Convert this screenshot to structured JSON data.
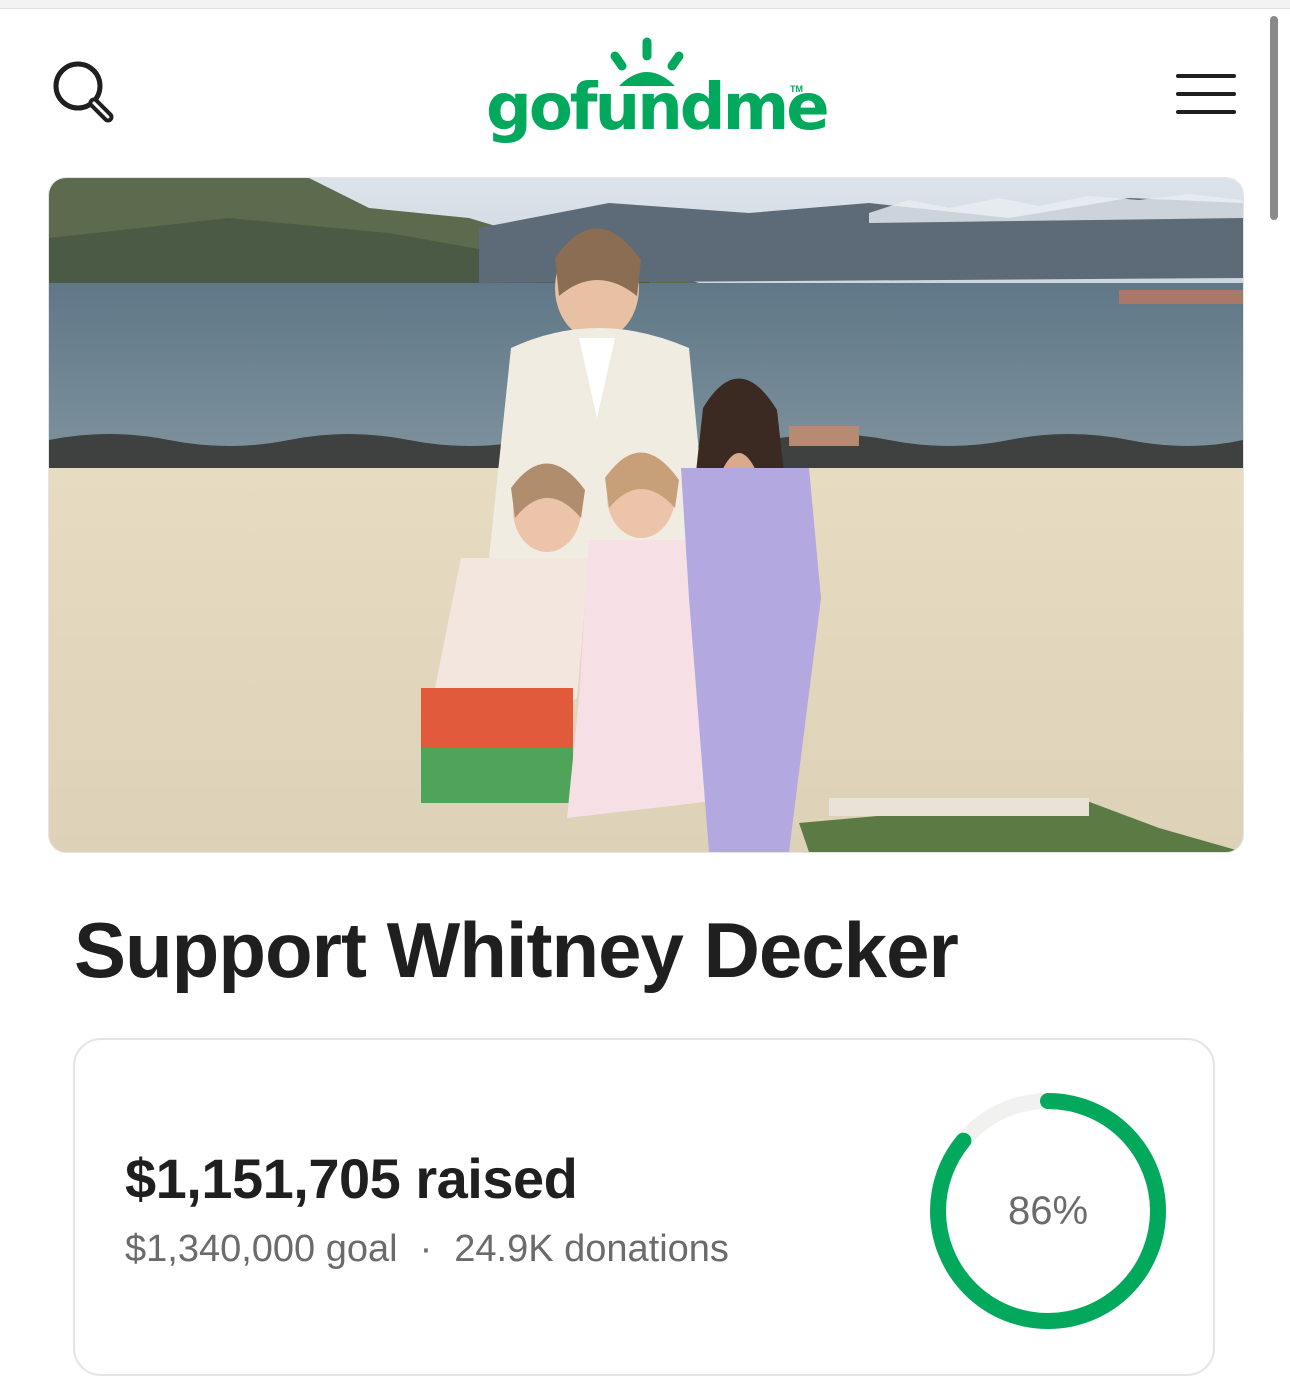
{
  "header": {
    "logo_text": "gofundme",
    "logo_tm": "TM",
    "brand_color": "#02a95c"
  },
  "icons": {
    "search": "search-icon",
    "menu": "hamburger-menu-icon"
  },
  "hero": {
    "description_colors": {
      "sky": "#c9d3dc",
      "water": "#6d8391",
      "sand": "#e6dcc5"
    }
  },
  "campaign": {
    "title": "Support Whitney Decker"
  },
  "progress": {
    "raised_text": "$1,151,705 raised",
    "goal_text": "$1,340,000 goal",
    "separator": "·",
    "donations_text": "24.9K donations",
    "percent_label": "86%",
    "percent_value": 0.86,
    "ring_color": "#02a95c",
    "track_color": "#f1f1ef"
  }
}
